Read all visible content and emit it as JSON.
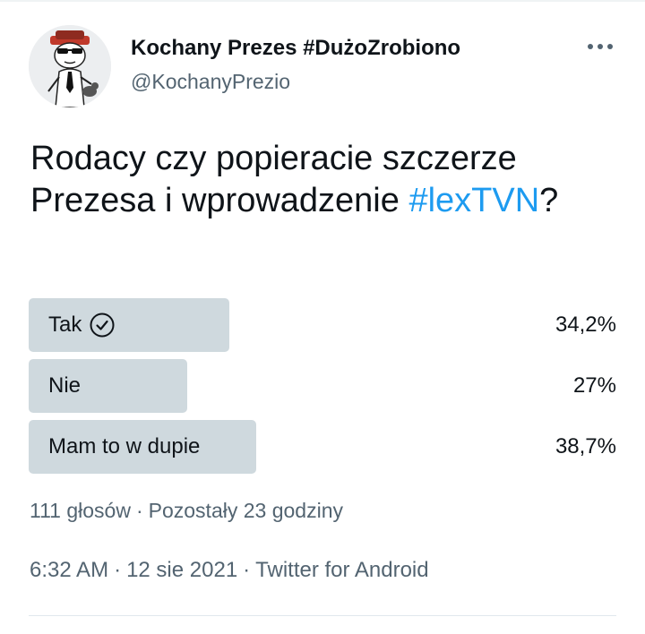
{
  "author": {
    "display_name": "Kochany Prezes #DużoZrobiono",
    "handle": "@KochanyPrezio",
    "avatar_icon": "cartoon-avatar-icon"
  },
  "tweet": {
    "text_before": "Rodacy czy popieracie szczerze Prezesa i wprowadzenie ",
    "hashtag": "#lexTVN",
    "text_after": "?",
    "hashtag_color": "#1d9bf0"
  },
  "poll": {
    "options": [
      {
        "label": "Tak",
        "percent_label": "34,2%",
        "fraction": 0.342,
        "selected": true
      },
      {
        "label": "Nie",
        "percent_label": "27%",
        "fraction": 0.27,
        "selected": false
      },
      {
        "label": "Mam to w dupie",
        "percent_label": "38,7%",
        "fraction": 0.387,
        "selected": false
      }
    ],
    "bar_color": "#cfd9de",
    "votes": "111 głosów",
    "separator": "·",
    "remaining": "Pozostały 23 godziny"
  },
  "meta": {
    "time": "6:32 AM",
    "date": "12 sie 2021",
    "source": "Twitter for Android",
    "separator": "·"
  },
  "colors": {
    "text": "#0f1419",
    "secondary": "#536471"
  }
}
